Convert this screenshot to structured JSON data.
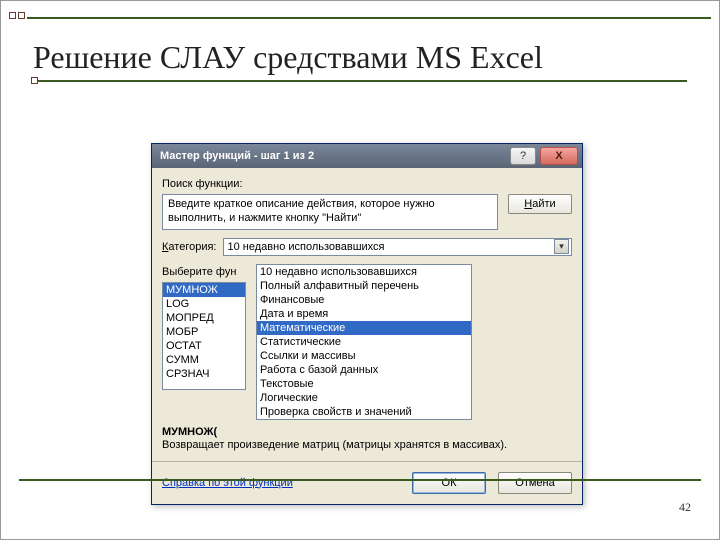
{
  "slide": {
    "title": "Решение СЛАУ средствами MS Excel",
    "page_number": "42"
  },
  "dialog": {
    "title": "Мастер функций - шаг 1 из 2",
    "help_tooltip": "?",
    "close_tooltip": "X",
    "search_label": "Поиск функции:",
    "search_text": "Введите краткое описание действия, которое нужно выполнить, и нажмите кнопку \"Найти\"",
    "find_label": "Найти",
    "category_label": "Категория:",
    "category_value": "10 недавно использовавшихся",
    "choose_label": "Выберите фун",
    "functions": [
      "МУМНОЖ",
      "LOG",
      "МОПРЕД",
      "МОБР",
      "ОСТАТ",
      "СУММ",
      "СРЗНАЧ"
    ],
    "selected_function_index": 0,
    "categories": [
      "10 недавно использовавшихся",
      "Полный алфавитный перечень",
      "Финансовые",
      "Дата и время",
      "Математические",
      "Статистические",
      "Ссылки и массивы",
      "Работа с базой данных",
      "Текстовые",
      "Логические",
      "Проверка свойств и значений"
    ],
    "selected_category_index": 4,
    "signature": "МУМНОЖ(",
    "description": "Возвращает произведение матриц (матрицы хранятся в массивах).",
    "help_link": "Справка по этой функции",
    "ok_label": "ОК",
    "cancel_label": "Отмена"
  }
}
